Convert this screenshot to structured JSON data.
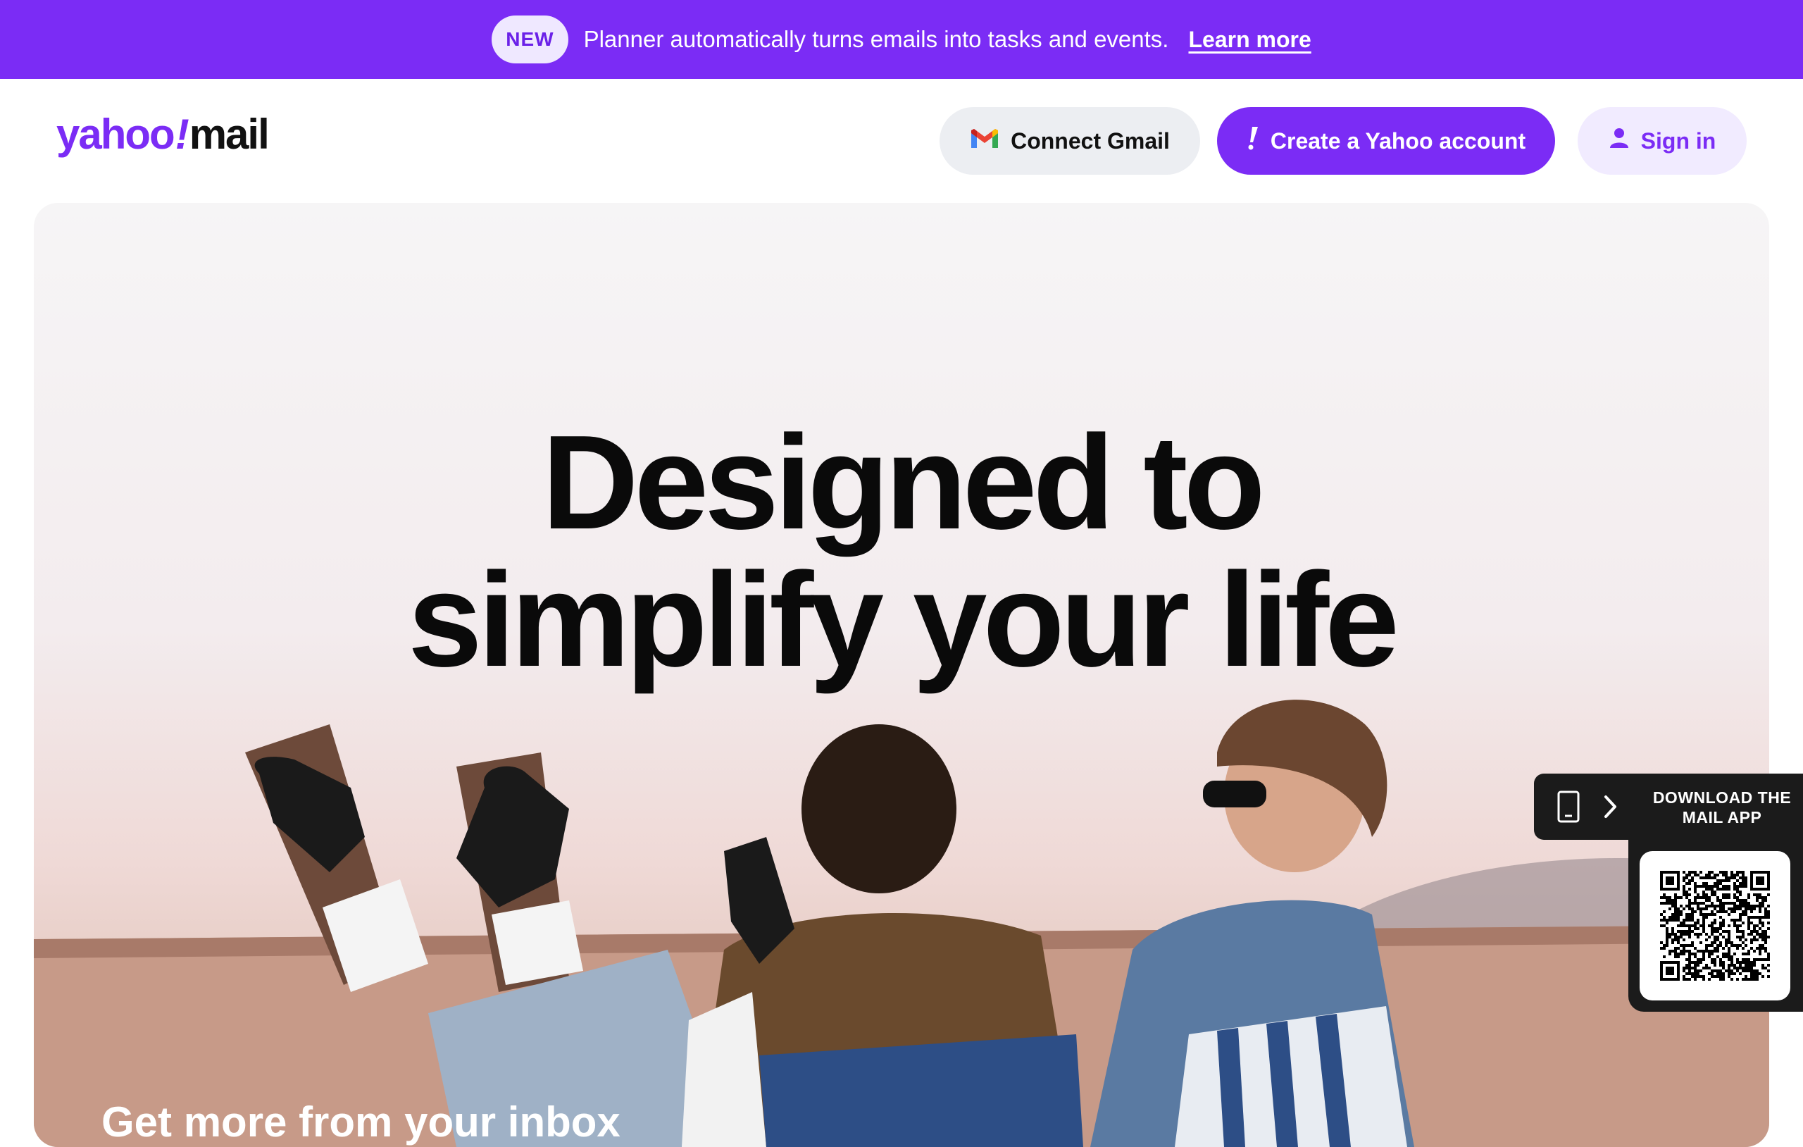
{
  "promo": {
    "badge": "NEW",
    "text": "Planner automatically turns emails into tasks and events.",
    "link": "Learn more"
  },
  "header": {
    "logo": {
      "yahoo": "yahoo",
      "mark": "!",
      "mail": "mail"
    },
    "connect_gmail": "Connect Gmail",
    "create_account": "Create a Yahoo account",
    "sign_in": "Sign in"
  },
  "hero": {
    "title_line1": "Designed to",
    "title_line2": "simplify your life",
    "subtitle": "Get more from your inbox"
  },
  "download": {
    "label_line1": "DOWNLOAD THE",
    "label_line2": "MAIL APP"
  },
  "colors": {
    "brand_purple": "#7b2cf5",
    "banner": "#7b2cf5",
    "widget_dark": "#1b1b1b"
  },
  "icons": {
    "gmail": "gmail-m-icon",
    "create": "exclamation-icon",
    "sign_in": "user-icon",
    "download_phone": "phone-icon",
    "download_chevron": "chevron-right-icon",
    "qr": "qr-code"
  }
}
